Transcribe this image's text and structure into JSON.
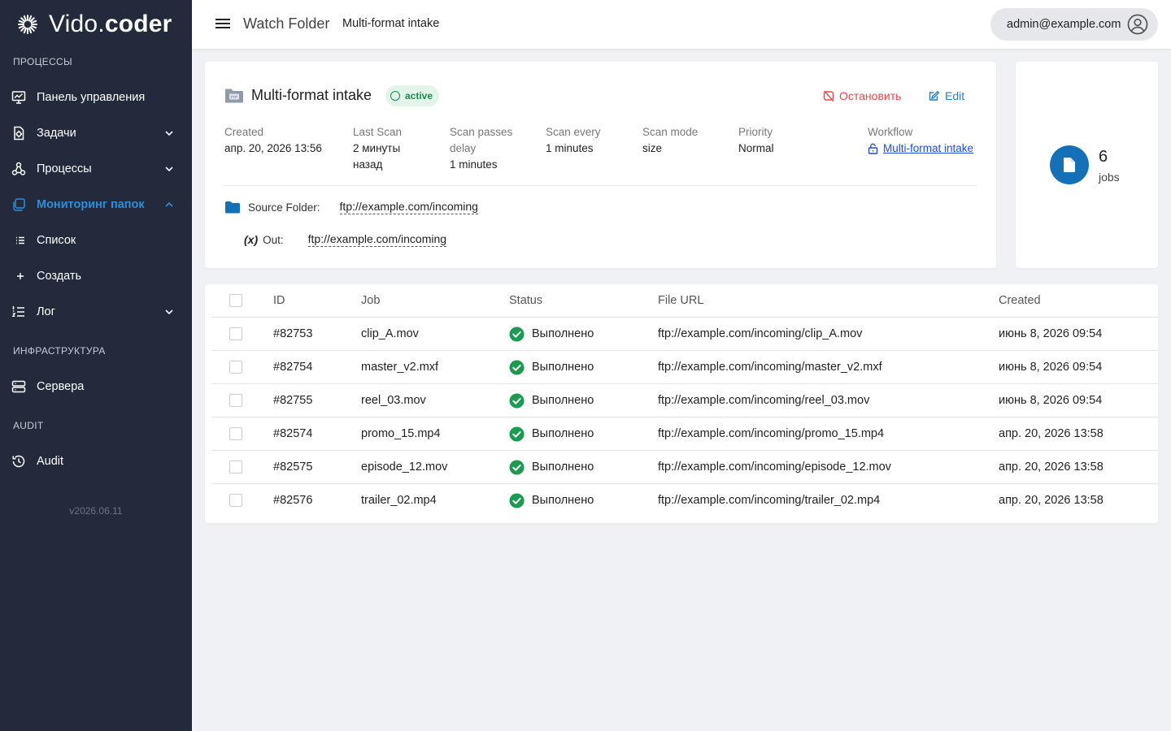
{
  "brand": {
    "name_light": "Vido.",
    "name_bold": "coder"
  },
  "sidebar": {
    "section_processes": "ПРОЦЕССЫ",
    "section_infra": "ИНФРАСТРУКТУРА",
    "section_audit": "AUDIT",
    "items": {
      "dashboard": "Панель управления",
      "tasks": "Задачи",
      "processes": "Процессы",
      "watch": "Мониторинг папок",
      "list": "Список",
      "create": "Создать",
      "log": "Лог",
      "servers": "Сервера",
      "audit": "Audit"
    },
    "version": "v2026.06.11"
  },
  "topbar": {
    "title": "Watch Folder",
    "subtitle": "Multi-format intake",
    "user": "admin@example.com"
  },
  "info": {
    "title": "Multi-format intake",
    "status": "active",
    "stop_label": "Остановить",
    "edit_label": "Edit",
    "created_label": "Created",
    "created_value": "апр. 20, 2026 13:56",
    "last_scan_label": "Last Scan",
    "last_scan_value_1": "2 минуты",
    "last_scan_value_2": "назад",
    "delay_label_1": "Scan passes",
    "delay_label_2": "delay",
    "delay_value": "1 minutes",
    "every_label": "Scan every",
    "every_value": "1 minutes",
    "mode_label": "Scan mode",
    "mode_value": "size",
    "priority_label": "Priority",
    "priority_value": "Normal",
    "workflow_label": "Workflow",
    "workflow_value": "Multi-format intake",
    "source_label": "Source Folder:",
    "source_value": "ftp://example.com/incoming",
    "out_var": "(x)",
    "out_label": "Out:",
    "out_value": "ftp://example.com/incoming"
  },
  "jobs": {
    "count": "6",
    "label": "jobs"
  },
  "table": {
    "headers": {
      "id": "ID",
      "job": "Job",
      "status": "Status",
      "url": "File URL",
      "created": "Created"
    },
    "rows": [
      {
        "id": "#82753",
        "job": "clip_A.mov",
        "status": "Выполнено",
        "url": "ftp://example.com/incoming/clip_A.mov",
        "created": "июнь 8, 2026 09:54"
      },
      {
        "id": "#82754",
        "job": "master_v2.mxf",
        "status": "Выполнено",
        "url": "ftp://example.com/incoming/master_v2.mxf",
        "created": "июнь 8, 2026 09:54"
      },
      {
        "id": "#82755",
        "job": "reel_03.mov",
        "status": "Выполнено",
        "url": "ftp://example.com/incoming/reel_03.mov",
        "created": "июнь 8, 2026 09:54"
      },
      {
        "id": "#82574",
        "job": "promo_15.mp4",
        "status": "Выполнено",
        "url": "ftp://example.com/incoming/promo_15.mp4",
        "created": "апр. 20, 2026 13:58"
      },
      {
        "id": "#82575",
        "job": "episode_12.mov",
        "status": "Выполнено",
        "url": "ftp://example.com/incoming/episode_12.mov",
        "created": "апр. 20, 2026 13:58"
      },
      {
        "id": "#82576",
        "job": "trailer_02.mp4",
        "status": "Выполнено",
        "url": "ftp://example.com/incoming/trailer_02.mp4",
        "created": "апр. 20, 2026 13:58"
      }
    ]
  }
}
